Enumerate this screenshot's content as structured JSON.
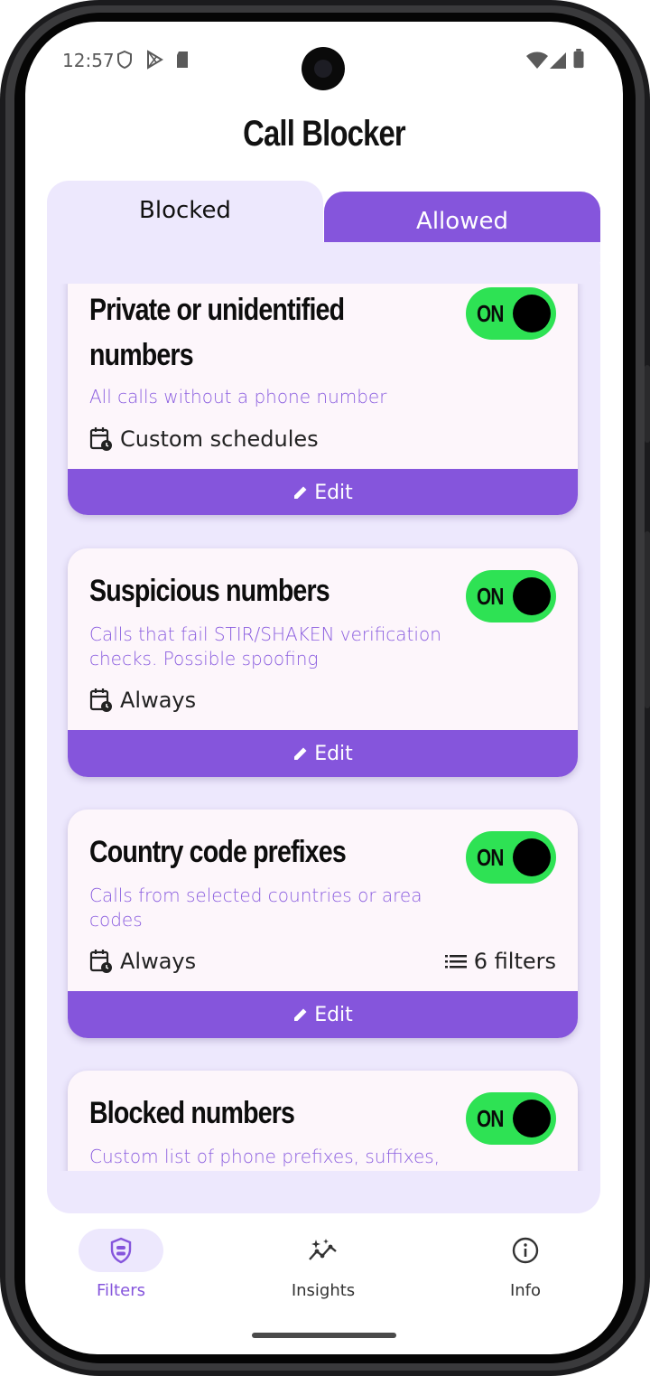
{
  "status_bar": {
    "time": "12:57"
  },
  "app": {
    "title": "Call Blocker"
  },
  "tabs": [
    {
      "label": "Blocked",
      "selected": true
    },
    {
      "label": "Allowed",
      "selected": false
    }
  ],
  "colors": {
    "accent": "#8555dc",
    "panel": "#ede8fd",
    "toggle_on": "#2ee254",
    "card": "#fdf6fb"
  },
  "cards": [
    {
      "title": "Private or unidentified numbers",
      "description": "All calls without a phone number",
      "schedule": "Custom schedules",
      "toggle": "ON",
      "edit_label": "Edit"
    },
    {
      "title": "Suspicious numbers",
      "description": "Calls that fail STIR/SHAKEN verification checks. Possible spoofing",
      "schedule": "Always",
      "toggle": "ON",
      "edit_label": "Edit"
    },
    {
      "title": "Country code prefixes",
      "description": "Calls from selected countries or area codes",
      "schedule": "Always",
      "filters": "6 filters",
      "toggle": "ON",
      "edit_label": "Edit"
    },
    {
      "title": "Blocked numbers",
      "description": "Custom list of phone prefixes, suffixes,",
      "toggle": "ON"
    }
  ],
  "nav": [
    {
      "label": "Filters",
      "icon": "shield-filter-icon",
      "active": true
    },
    {
      "label": "Insights",
      "icon": "insights-sparkle-icon",
      "active": false
    },
    {
      "label": "Info",
      "icon": "info-icon",
      "active": false
    }
  ]
}
